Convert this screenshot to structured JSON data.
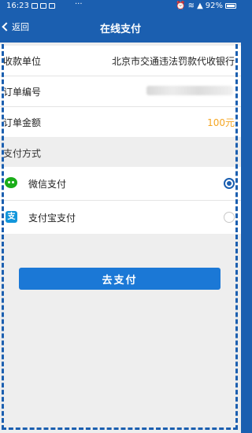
{
  "status_bar": {
    "time": "16:23",
    "overflow_dots": "···",
    "battery_text": "92%"
  },
  "header": {
    "back_label": "返回",
    "title": "在线支付"
  },
  "order": {
    "payee_label": "收款单位",
    "payee_value": "北京市交通违法罚款代收银行",
    "order_no_label": "订单编号",
    "amount_label": "订单金额",
    "amount_value": "100元"
  },
  "payment": {
    "section_title": "支付方式",
    "methods": [
      {
        "label": "微信支付",
        "selected": true,
        "icon": "wechat-icon"
      },
      {
        "label": "支付宝支付",
        "selected": false,
        "icon": "alipay-icon"
      }
    ]
  },
  "submit_label": "去支付",
  "colors": {
    "primary": "#1b5fb0",
    "button": "#1b78d6",
    "amount": "#f5a623",
    "wechat": "#1aad19",
    "alipay": "#1296db"
  }
}
